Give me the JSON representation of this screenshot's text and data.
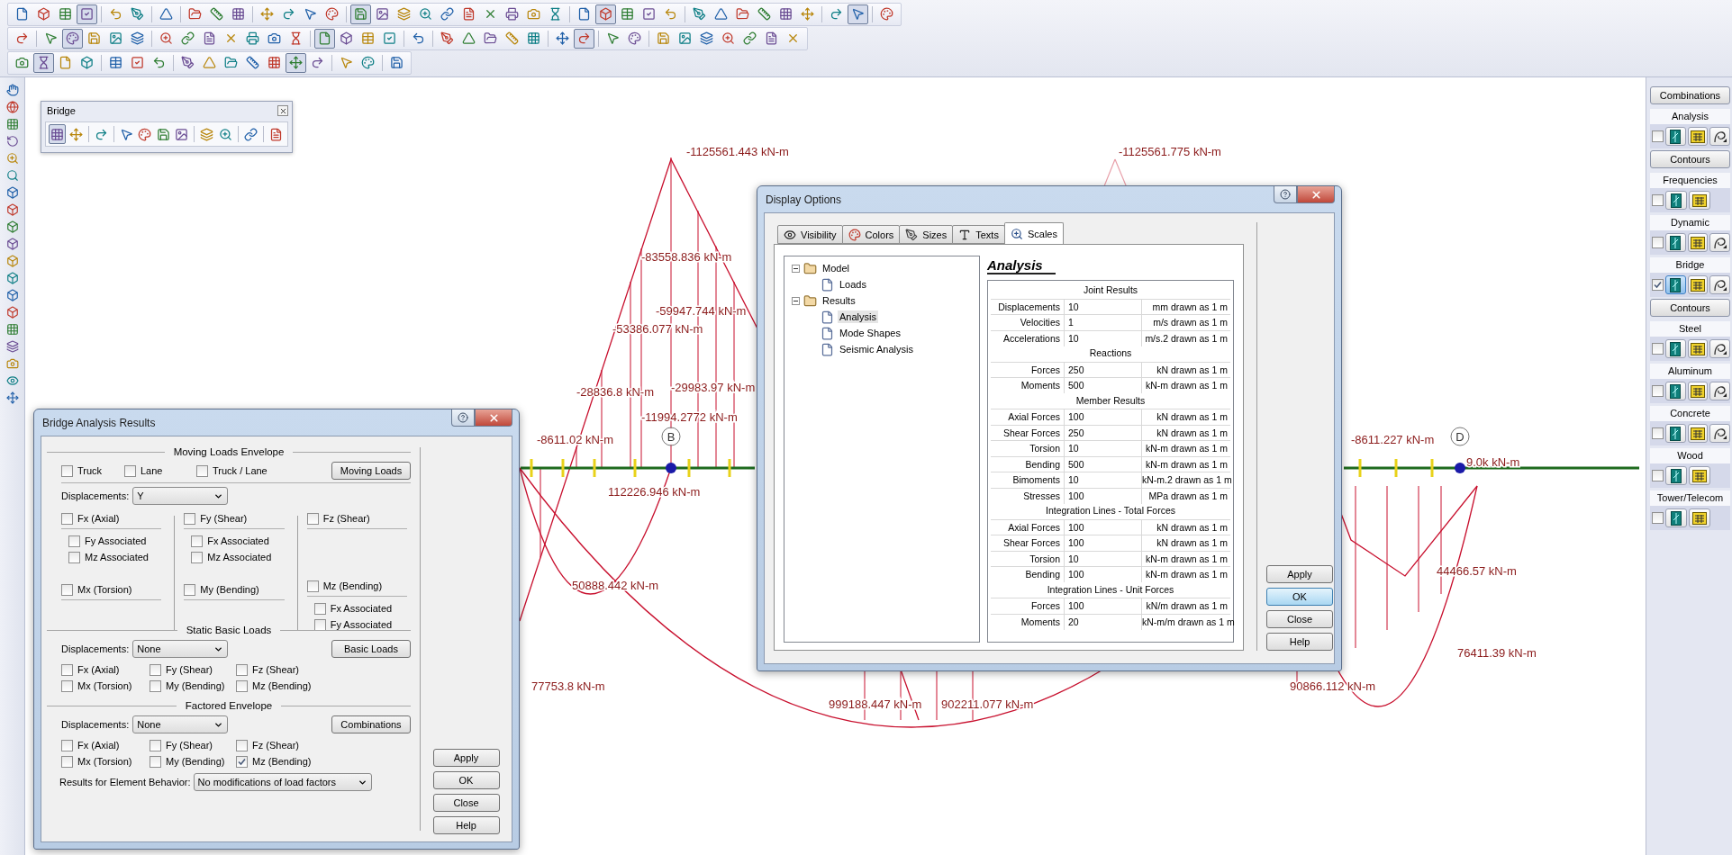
{
  "bridge_toolbar": {
    "title": "Bridge"
  },
  "canvas": {
    "labels": [
      "-1125561.443 kN-m",
      "-1125561.775 kN-m",
      "-83558.836 kN-m",
      "-59947.744 kN-m",
      "-53386.077 kN-m",
      "-28836.8 kN-m",
      "-29983.97 kN-m",
      "-11994.2772 kN-m",
      "-8611.02 kN-m",
      "112226.946 kN-m",
      "50888.442 kN-m",
      "77753.8 kN-m",
      "999188.447 kN-m",
      "902211.077 kN-m",
      "-8611.227 kN-m",
      "9.0k kN-m",
      "44466.57 kN-m",
      "76411.39 kN-m",
      "90866.112 kN-m"
    ],
    "nodes": [
      {
        "label": "B"
      },
      {
        "label": "D"
      }
    ]
  },
  "right_panel": {
    "items": [
      {
        "kind": "button",
        "label": "Combinations"
      },
      {
        "kind": "section",
        "label": "Analysis",
        "checked": false,
        "tools": [
          {
            "kind": "diagram",
            "selected": false
          },
          {
            "kind": "table",
            "selected": false
          },
          {
            "kind": "contour",
            "selected": false
          }
        ]
      },
      {
        "kind": "button",
        "label": "Contours"
      },
      {
        "kind": "section",
        "label": "Frequencies",
        "checked": false,
        "tools": [
          {
            "kind": "diagram",
            "selected": false
          },
          {
            "kind": "table",
            "selected": false
          }
        ]
      },
      {
        "kind": "section",
        "label": "Dynamic",
        "checked": false,
        "tools": [
          {
            "kind": "diagram",
            "selected": false
          },
          {
            "kind": "table",
            "selected": false
          },
          {
            "kind": "contour",
            "selected": false
          }
        ]
      },
      {
        "kind": "section",
        "label": "Bridge",
        "checked": true,
        "tools": [
          {
            "kind": "diagram",
            "selected": true
          },
          {
            "kind": "table",
            "selected": false
          },
          {
            "kind": "contour",
            "selected": false
          }
        ]
      },
      {
        "kind": "button",
        "label": "Contours"
      },
      {
        "kind": "section",
        "label": "Steel",
        "checked": false,
        "tools": [
          {
            "kind": "diagram",
            "selected": false
          },
          {
            "kind": "table",
            "selected": false
          },
          {
            "kind": "contour",
            "selected": false
          }
        ]
      },
      {
        "kind": "section",
        "label": "Aluminum",
        "checked": false,
        "tools": [
          {
            "kind": "diagram",
            "selected": false
          },
          {
            "kind": "table",
            "selected": false
          },
          {
            "kind": "contour",
            "selected": false
          }
        ]
      },
      {
        "kind": "section",
        "label": "Concrete",
        "checked": false,
        "tools": [
          {
            "kind": "diagram",
            "selected": false
          },
          {
            "kind": "table",
            "selected": false
          },
          {
            "kind": "contour",
            "selected": false
          }
        ]
      },
      {
        "kind": "section",
        "label": "Wood",
        "checked": false,
        "tools": [
          {
            "kind": "diagram",
            "selected": false
          },
          {
            "kind": "table",
            "selected": false
          }
        ]
      },
      {
        "kind": "section",
        "label": "Tower/Telecom",
        "checked": false,
        "tools": [
          {
            "kind": "diagram",
            "selected": false
          },
          {
            "kind": "table",
            "selected": false
          }
        ]
      }
    ]
  },
  "bridge_results": {
    "title": "Bridge Analysis Results",
    "moving": {
      "heading": "Moving Loads Envelope",
      "checks": [
        {
          "label": "Truck",
          "checked": false
        },
        {
          "label": "Lane",
          "checked": false
        },
        {
          "label": "Truck / Lane",
          "checked": false
        }
      ],
      "button": "Moving Loads",
      "displacements": {
        "label": "Displacements:",
        "value": "Y"
      },
      "columns": [
        {
          "entries": [
            {
              "label": "Fx (Axial)",
              "checked": false,
              "associated": [
                {
                  "label": "Fy Associated",
                  "checked": false
                },
                {
                  "label": "Mz Associated",
                  "checked": false
                }
              ]
            },
            {
              "label": "Mx (Torsion)",
              "checked": false
            }
          ]
        },
        {
          "entries": [
            {
              "label": "Fy (Shear)",
              "checked": false,
              "associated": [
                {
                  "label": "Fx Associated",
                  "checked": false
                },
                {
                  "label": "Mz Associated",
                  "checked": false
                }
              ]
            },
            {
              "label": "My (Bending)",
              "checked": false
            }
          ]
        },
        {
          "entries": [
            {
              "label": "Fz (Shear)",
              "checked": false
            },
            {
              "label": "Mz (Bending)",
              "checked": false,
              "associated": [
                {
                  "label": "Fx Associated",
                  "checked": false
                },
                {
                  "label": "Fy Associated",
                  "checked": false
                }
              ]
            }
          ]
        }
      ]
    },
    "static": {
      "heading": "Static Basic Loads",
      "displacements": {
        "label": "Displacements:",
        "value": "None"
      },
      "button": "Basic Loads",
      "checks": [
        {
          "label": "Fx (Axial)",
          "checked": false
        },
        {
          "label": "Fy (Shear)",
          "checked": false
        },
        {
          "label": "Fz (Shear)",
          "checked": false
        },
        {
          "label": "Mx (Torsion)",
          "checked": false
        },
        {
          "label": "My (Bending)",
          "checked": false
        },
        {
          "label": "Mz (Bending)",
          "checked": false
        }
      ]
    },
    "factored": {
      "heading": "Factored Envelope",
      "displacements": {
        "label": "Displacements:",
        "value": "None"
      },
      "button": "Combinations",
      "checks": [
        {
          "label": "Fx (Axial)",
          "checked": false
        },
        {
          "label": "Fy (Shear)",
          "checked": false
        },
        {
          "label": "Fz (Shear)",
          "checked": false
        },
        {
          "label": "Mx (Torsion)",
          "checked": false
        },
        {
          "label": "My (Bending)",
          "checked": false
        },
        {
          "label": "Mz (Bending)",
          "checked": true
        }
      ]
    },
    "behavior": {
      "label": "Results for Element Behavior:",
      "value": "No modifications of load factors"
    },
    "buttons": [
      "Apply",
      "OK",
      "Close",
      "Help"
    ]
  },
  "display_options": {
    "title": "Display Options",
    "tabs": [
      {
        "label": "Visibility",
        "selected": false
      },
      {
        "label": "Colors",
        "selected": false
      },
      {
        "label": "Sizes",
        "selected": false
      },
      {
        "label": "Texts",
        "selected": false
      },
      {
        "label": "Scales",
        "selected": true
      }
    ],
    "tree": [
      {
        "label": "Model",
        "expanded": true,
        "children": [
          {
            "label": "Loads",
            "selected": false
          }
        ]
      },
      {
        "label": "Results",
        "expanded": true,
        "children": [
          {
            "label": "Analysis",
            "selected": true
          },
          {
            "label": "Mode Shapes",
            "selected": false
          },
          {
            "label": "Seismic Analysis",
            "selected": false
          }
        ]
      }
    ],
    "heading": "Analysis",
    "groups": [
      {
        "title": "Joint Results",
        "rows": [
          {
            "label": "Displacements",
            "value": "10",
            "unit": "mm drawn as 1 m"
          },
          {
            "label": "Velocities",
            "value": "1",
            "unit": "m/s drawn as 1 m"
          },
          {
            "label": "Accelerations",
            "value": "10",
            "unit": "m/s.2 drawn as 1 m"
          }
        ]
      },
      {
        "title": "Reactions",
        "rows": [
          {
            "label": "Forces",
            "value": "250",
            "unit": "kN drawn as 1 m"
          },
          {
            "label": "Moments",
            "value": "500",
            "unit": "kN-m drawn as 1 m"
          }
        ]
      },
      {
        "title": "Member Results",
        "rows": [
          {
            "label": "Axial Forces",
            "value": "100",
            "unit": "kN drawn as 1 m"
          },
          {
            "label": "Shear Forces",
            "value": "250",
            "unit": "kN drawn as 1 m"
          },
          {
            "label": "Torsion",
            "value": "10",
            "unit": "kN-m drawn as 1 m"
          },
          {
            "label": "Bending",
            "value": "500",
            "unit": "kN-m drawn as 1 m"
          },
          {
            "label": "Bimoments",
            "value": "10",
            "unit": "kN-m.2 drawn as 1 m"
          },
          {
            "label": "Stresses",
            "value": "100",
            "unit": "MPa drawn as 1 m"
          }
        ]
      },
      {
        "title": "Integration Lines - Total Forces",
        "rows": [
          {
            "label": "Axial Forces",
            "value": "100",
            "unit": "kN drawn as 1 m"
          },
          {
            "label": "Shear Forces",
            "value": "100",
            "unit": "kN drawn as 1 m"
          },
          {
            "label": "Torsion",
            "value": "10",
            "unit": "kN-m drawn as 1 m"
          },
          {
            "label": "Bending",
            "value": "100",
            "unit": "kN-m drawn as 1 m"
          }
        ]
      },
      {
        "title": "Integration Lines - Unit Forces",
        "rows": [
          {
            "label": "Forces",
            "value": "100",
            "unit": "kN/m drawn as 1 m"
          },
          {
            "label": "Moments",
            "value": "20",
            "unit": "kN-m/m drawn as 1 m"
          }
        ]
      }
    ],
    "buttons": [
      {
        "label": "Apply",
        "focused": false
      },
      {
        "label": "OK",
        "focused": true
      },
      {
        "label": "Close",
        "focused": false
      },
      {
        "label": "Help",
        "focused": false
      }
    ]
  }
}
